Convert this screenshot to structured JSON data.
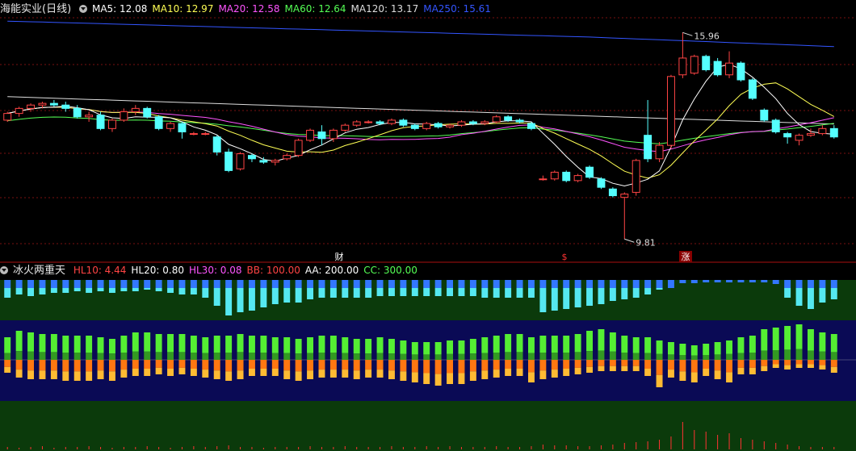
{
  "main_panel": {
    "title": "海能实业(日线)",
    "indicators": [
      {
        "label": "MA5: 12.08",
        "color": "#ffffff"
      },
      {
        "label": "MA10: 12.97",
        "color": "#ffff55"
      },
      {
        "label": "MA20: 12.58",
        "color": "#ff55ff"
      },
      {
        "label": "MA60: 12.64",
        "color": "#55ff55"
      },
      {
        "label": "MA120: 13.17",
        "color": "#dddddd"
      },
      {
        "label": "MA250: 15.61",
        "color": "#3355ff"
      }
    ],
    "high_label": "15.96",
    "low_label": "9.81",
    "markers": [
      {
        "text": "财",
        "color": "#ffffff"
      },
      {
        "text": "$",
        "color": "#ff3333"
      },
      {
        "text": "涨",
        "color": "#ffffff"
      }
    ]
  },
  "sub_panel": {
    "title": "冰火两重天",
    "indicators": [
      {
        "label": "HL10: 4.44",
        "color": "#ff4444"
      },
      {
        "label": "HL20: 0.80",
        "color": "#ffffff"
      },
      {
        "label": "HL30: 0.08",
        "color": "#ff55ff"
      },
      {
        "label": "BB: 100.00",
        "color": "#ff4444"
      },
      {
        "label": "AA: 200.00",
        "color": "#ffffff"
      },
      {
        "label": "CC: 300.00",
        "color": "#55ff55"
      }
    ]
  },
  "colors": {
    "up": "#ff4444",
    "down": "#55ffff",
    "grid": "#7a1010",
    "ice_bg": "#0b3a0b",
    "fire_bg": "#0a0a55",
    "bottom_bg": "#0b3a0b"
  },
  "candles": [
    [
      13.35,
      13.6,
      13.3,
      13.55
    ],
    [
      13.55,
      13.75,
      13.45,
      13.7
    ],
    [
      13.7,
      13.85,
      13.6,
      13.8
    ],
    [
      13.8,
      13.9,
      13.7,
      13.85
    ],
    [
      13.85,
      13.95,
      13.75,
      13.8
    ],
    [
      13.8,
      13.9,
      13.6,
      13.7
    ],
    [
      13.7,
      13.8,
      13.4,
      13.45
    ],
    [
      13.45,
      13.6,
      13.3,
      13.5
    ],
    [
      13.5,
      13.6,
      13.05,
      13.1
    ],
    [
      13.1,
      13.4,
      13.0,
      13.35
    ],
    [
      13.35,
      13.7,
      13.3,
      13.6
    ],
    [
      13.6,
      13.8,
      13.5,
      13.7
    ],
    [
      13.7,
      13.75,
      13.4,
      13.45
    ],
    [
      13.45,
      13.5,
      13.05,
      13.1
    ],
    [
      13.1,
      13.3,
      13.0,
      13.25
    ],
    [
      13.25,
      13.3,
      12.8,
      13.0
    ],
    [
      12.95,
      13.0,
      12.9,
      12.95
    ],
    [
      12.95,
      13.0,
      12.9,
      12.95
    ],
    [
      12.85,
      12.9,
      12.3,
      12.4
    ],
    [
      12.4,
      12.5,
      11.8,
      11.85
    ],
    [
      11.9,
      12.4,
      11.85,
      12.35
    ],
    [
      12.3,
      12.35,
      12.1,
      12.2
    ],
    [
      12.15,
      12.25,
      12.05,
      12.1
    ],
    [
      12.1,
      12.2,
      12.0,
      12.15
    ],
    [
      12.2,
      12.35,
      12.15,
      12.3
    ],
    [
      12.3,
      12.8,
      12.25,
      12.75
    ],
    [
      12.75,
      13.1,
      12.7,
      13.05
    ],
    [
      13.0,
      13.2,
      12.6,
      12.8
    ],
    [
      12.8,
      13.1,
      12.7,
      13.05
    ],
    [
      13.05,
      13.25,
      13.0,
      13.2
    ],
    [
      13.2,
      13.35,
      13.15,
      13.3
    ],
    [
      13.3,
      13.35,
      13.25,
      13.3
    ],
    [
      13.3,
      13.35,
      13.2,
      13.25
    ],
    [
      13.25,
      13.4,
      13.2,
      13.35
    ],
    [
      13.35,
      13.4,
      13.15,
      13.2
    ],
    [
      13.2,
      13.25,
      13.05,
      13.1
    ],
    [
      13.1,
      13.3,
      13.05,
      13.25
    ],
    [
      13.25,
      13.3,
      13.1,
      13.15
    ],
    [
      13.15,
      13.25,
      13.1,
      13.2
    ],
    [
      13.2,
      13.35,
      13.15,
      13.3
    ],
    [
      13.3,
      13.35,
      13.2,
      13.25
    ],
    [
      13.25,
      13.35,
      13.2,
      13.3
    ],
    [
      13.3,
      13.5,
      13.25,
      13.45
    ],
    [
      13.45,
      13.5,
      13.3,
      13.35
    ],
    [
      13.35,
      13.4,
      13.25,
      13.3
    ],
    [
      13.25,
      13.3,
      13.05,
      13.1
    ],
    [
      11.6,
      11.7,
      11.55,
      11.6
    ],
    [
      11.6,
      11.85,
      11.55,
      11.8
    ],
    [
      11.8,
      11.85,
      11.5,
      11.55
    ],
    [
      11.55,
      11.75,
      11.5,
      11.7
    ],
    [
      11.95,
      12.0,
      11.6,
      11.65
    ],
    [
      11.6,
      11.65,
      11.3,
      11.35
    ],
    [
      11.3,
      11.35,
      11.05,
      11.1
    ],
    [
      11.05,
      11.2,
      9.81,
      11.15
    ],
    [
      11.2,
      12.2,
      11.1,
      12.15
    ],
    [
      12.9,
      13.95,
      12.1,
      12.2
    ],
    [
      12.2,
      12.7,
      12.1,
      12.6
    ],
    [
      12.6,
      14.7,
      12.5,
      14.65
    ],
    [
      14.7,
      15.96,
      14.6,
      15.2
    ],
    [
      14.75,
      15.3,
      14.7,
      15.25
    ],
    [
      15.25,
      15.3,
      14.8,
      14.85
    ],
    [
      15.1,
      15.2,
      14.65,
      14.7
    ],
    [
      14.7,
      15.4,
      14.6,
      15.05
    ],
    [
      15.05,
      15.1,
      14.5,
      14.55
    ],
    [
      14.55,
      14.6,
      13.95,
      14.0
    ],
    [
      13.65,
      13.7,
      13.3,
      13.35
    ],
    [
      13.35,
      13.4,
      12.95,
      13.0
    ],
    [
      12.95,
      13.0,
      12.65,
      12.85
    ],
    [
      12.75,
      12.95,
      12.6,
      12.9
    ],
    [
      12.9,
      13.1,
      12.85,
      12.95
    ],
    [
      12.95,
      13.2,
      12.9,
      13.1
    ],
    [
      13.1,
      13.2,
      12.8,
      12.85
    ]
  ],
  "ice_heights": [
    22,
    18,
    20,
    18,
    16,
    16,
    14,
    16,
    14,
    16,
    14,
    14,
    12,
    14,
    16,
    18,
    18,
    22,
    32,
    44,
    40,
    38,
    34,
    30,
    28,
    28,
    24,
    22,
    22,
    22,
    22,
    22,
    20,
    20,
    20,
    20,
    20,
    20,
    20,
    20,
    20,
    22,
    22,
    22,
    22,
    22,
    40,
    38,
    36,
    34,
    32,
    30,
    26,
    24,
    22,
    18,
    12,
    10,
    4,
    4,
    3,
    3,
    3,
    3,
    3,
    3,
    5,
    22,
    32,
    36,
    28,
    24
  ],
  "fire_up": [
    28,
    36,
    34,
    32,
    32,
    30,
    30,
    30,
    28,
    26,
    30,
    34,
    34,
    32,
    32,
    32,
    30,
    28,
    30,
    30,
    32,
    30,
    30,
    28,
    28,
    26,
    28,
    30,
    30,
    28,
    26,
    26,
    28,
    26,
    24,
    22,
    22,
    22,
    24,
    24,
    26,
    28,
    30,
    32,
    32,
    28,
    30,
    30,
    30,
    32,
    36,
    38,
    34,
    30,
    28,
    28,
    24,
    22,
    20,
    18,
    20,
    22,
    24,
    28,
    30,
    38,
    40,
    42,
    44,
    38,
    34,
    32
  ],
  "fire_down": [
    16,
    22,
    24,
    24,
    24,
    26,
    26,
    26,
    24,
    26,
    22,
    20,
    20,
    18,
    20,
    18,
    20,
    22,
    24,
    26,
    24,
    20,
    20,
    20,
    24,
    26,
    24,
    22,
    22,
    22,
    24,
    22,
    22,
    24,
    26,
    28,
    30,
    32,
    30,
    30,
    26,
    24,
    22,
    20,
    20,
    28,
    24,
    22,
    20,
    18,
    16,
    14,
    14,
    14,
    14,
    20,
    34,
    22,
    26,
    28,
    20,
    24,
    28,
    18,
    18,
    14,
    10,
    12,
    10,
    10,
    12,
    16
  ],
  "bottom_spikes": [
    3,
    2,
    3,
    4,
    2,
    3,
    3,
    4,
    3,
    2,
    3,
    3,
    4,
    3,
    2,
    3,
    4,
    3,
    4,
    5,
    3,
    3,
    2,
    3,
    3,
    3,
    4,
    3,
    3,
    4,
    3,
    3,
    3,
    4,
    3,
    3,
    4,
    3,
    4,
    3,
    3,
    3,
    4,
    3,
    3,
    4,
    6,
    5,
    5,
    4,
    4,
    5,
    6,
    8,
    9,
    10,
    12,
    16,
    34,
    24,
    22,
    18,
    20,
    14,
    12,
    10,
    8,
    6,
    4,
    3,
    3,
    3
  ]
}
